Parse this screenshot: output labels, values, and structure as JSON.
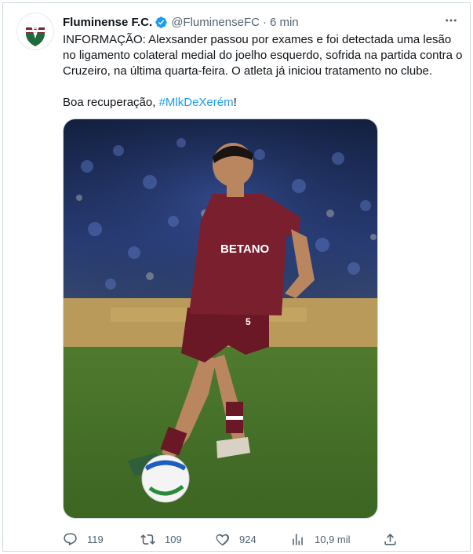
{
  "tweet": {
    "author": {
      "name": "Fluminense F.C.",
      "handle": "@FluminenseFC",
      "separator": "·",
      "time": "6 min",
      "verified": true
    },
    "text_line_1": "INFORMAÇÃO: Alexsander passou por exames e foi detectada uma lesão no ligamento colateral medial do joelho esquerdo, sofrida na partida contra o Cruzeiro, na última quarta-feira. O atleta já iniciou tratamento no clube.",
    "text_line_2_prefix": "Boa recuperação, ",
    "hashtag": "#MlkDeXerém",
    "text_line_2_suffix": "!",
    "actions": {
      "replies": "119",
      "retweets": "109",
      "likes": "924",
      "views": "10,9 mil"
    },
    "media": {
      "jersey_sponsor": "BETANO",
      "jersey_number": "5"
    }
  },
  "colors": {
    "accent": "#1d9bf0",
    "secondary_text": "#536471",
    "maroon": "#7a1f2e",
    "green": "#1e6b3b"
  }
}
